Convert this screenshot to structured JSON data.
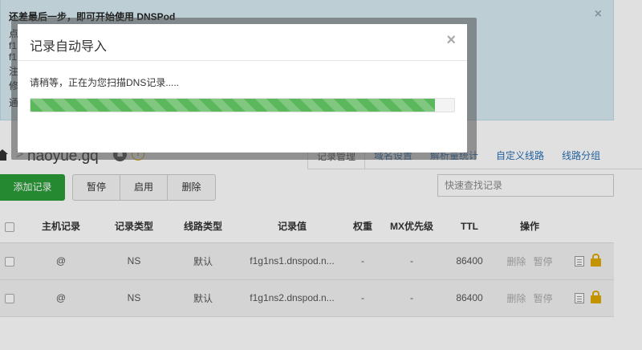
{
  "notice": {
    "title": "还差最后一步，即可开始使用 DNSPod",
    "fragments": [
      "点",
      "f1",
      "f1",
      "注",
      "修",
      "通"
    ]
  },
  "domain": {
    "name": "haoyue.gq"
  },
  "tabs": [
    {
      "label": "记录管理",
      "active": true
    },
    {
      "label": "域名设置",
      "active": false
    },
    {
      "label": "解析量统计",
      "active": false
    },
    {
      "label": "自定义线路",
      "active": false
    },
    {
      "label": "线路分组",
      "active": false
    }
  ],
  "toolbar": {
    "add_label": "添加记录",
    "pause_label": "暂停",
    "enable_label": "启用",
    "delete_label": "删除",
    "search_placeholder": "快速查找记录"
  },
  "table": {
    "headers": [
      "主机记录",
      "记录类型",
      "线路类型",
      "记录值",
      "权重",
      "MX优先级",
      "TTL",
      "操作"
    ],
    "rows": [
      {
        "host": "@",
        "type": "NS",
        "line": "默认",
        "value": "f1g1ns1.dnspod.n...",
        "weight": "-",
        "mx": "-",
        "ttl": "86400",
        "op_delete": "删除",
        "op_pause": "暂停"
      },
      {
        "host": "@",
        "type": "NS",
        "line": "默认",
        "value": "f1g1ns2.dnspod.n...",
        "weight": "-",
        "mx": "-",
        "ttl": "86400",
        "op_delete": "删除",
        "op_pause": "暂停"
      }
    ]
  },
  "modal": {
    "title": "记录自动导入",
    "close_glyph": "×",
    "message": "请稍等，正在为您扫描DNS记录.....",
    "progress": 0.955
  },
  "icons": {
    "notice_close": "close-icon",
    "home": "home-icon",
    "badge": "badge-icon",
    "info": "info-icon",
    "edit": "edit-icon",
    "lock": "lock-icon"
  },
  "colors": {
    "primary_green": "#2a9c38",
    "progress_green": "#5cb85c",
    "link_blue": "#2a6fb5",
    "notice_bg": "#d8ecf3",
    "lock_gold": "#e0a800"
  }
}
